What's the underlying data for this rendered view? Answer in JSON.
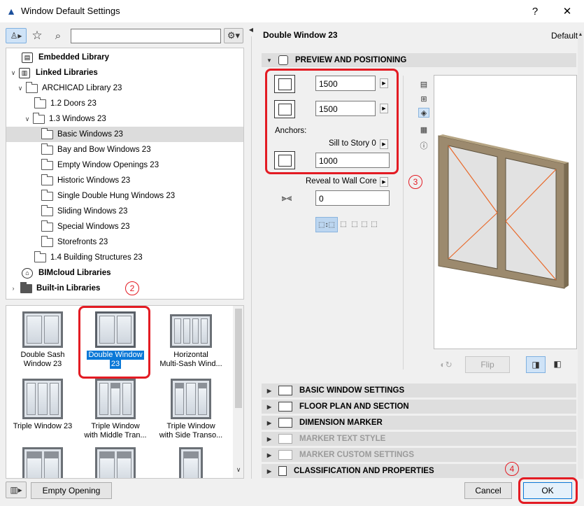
{
  "window": {
    "title": "Window Default Settings",
    "help_label": "?",
    "close_label": "✕"
  },
  "toolbar": {
    "search_placeholder": ""
  },
  "tree": [
    {
      "label": "Embedded Library",
      "bold": true
    },
    {
      "label": "Linked Libraries",
      "bold": true
    },
    {
      "label": "ARCHICAD Library 23"
    },
    {
      "label": "1.2 Doors 23"
    },
    {
      "label": "1.3 Windows 23"
    },
    {
      "label": "Basic Windows 23",
      "selected": true
    },
    {
      "label": "Bay and Bow Windows 23"
    },
    {
      "label": "Empty Window Openings 23"
    },
    {
      "label": "Historic Windows 23"
    },
    {
      "label": "Single Double Hung Windows 23"
    },
    {
      "label": "Sliding Windows 23"
    },
    {
      "label": "Special Windows 23"
    },
    {
      "label": "Storefronts 23"
    },
    {
      "label": "1.4 Building Structures 23"
    },
    {
      "label": "BIMcloud Libraries",
      "bold": true
    },
    {
      "label": "Built-in Libraries",
      "bold": true
    }
  ],
  "gallery": {
    "items": [
      {
        "line1": "Double Sash",
        "line2": "Window 23"
      },
      {
        "line1": "Double Window",
        "line2": "23",
        "selected": true
      },
      {
        "line1": "Horizontal",
        "line2": "Multi-Sash Wind..."
      },
      {
        "line1": "Triple Window 23",
        "line2": ""
      },
      {
        "line1": "Triple Window",
        "line2": "with Middle Tran..."
      },
      {
        "line1": "Triple Window",
        "line2": "with Side Transo..."
      }
    ]
  },
  "empty_opening_label": "Empty Opening",
  "right": {
    "title": "Double Window 23",
    "default_label": "Default",
    "preview_section": "PREVIEW AND POSITIONING",
    "width_value": "1500",
    "height_value": "1500",
    "anchors_label": "Anchors:",
    "sill_label": "Sill to Story 0",
    "sill_value": "1000",
    "reveal_label": "Reveal to Wall Core",
    "reveal_value": "0",
    "flip_label": "Flip"
  },
  "sections": [
    {
      "label": "BASIC WINDOW SETTINGS",
      "disabled": false
    },
    {
      "label": "FLOOR PLAN AND SECTION",
      "disabled": false
    },
    {
      "label": "DIMENSION MARKER",
      "disabled": false
    },
    {
      "label": "MARKER TEXT STYLE",
      "disabled": true
    },
    {
      "label": "MARKER CUSTOM SETTINGS",
      "disabled": true
    },
    {
      "label": "CLASSIFICATION AND PROPERTIES",
      "disabled": false
    }
  ],
  "buttons": {
    "cancel": "Cancel",
    "ok": "OK"
  },
  "badges": {
    "b2": "2",
    "b3": "3",
    "b4": "4"
  },
  "colors": {
    "annotation": "#e31b23",
    "selection": "#0a78d7",
    "frame_wood": "#9c8a6e"
  }
}
